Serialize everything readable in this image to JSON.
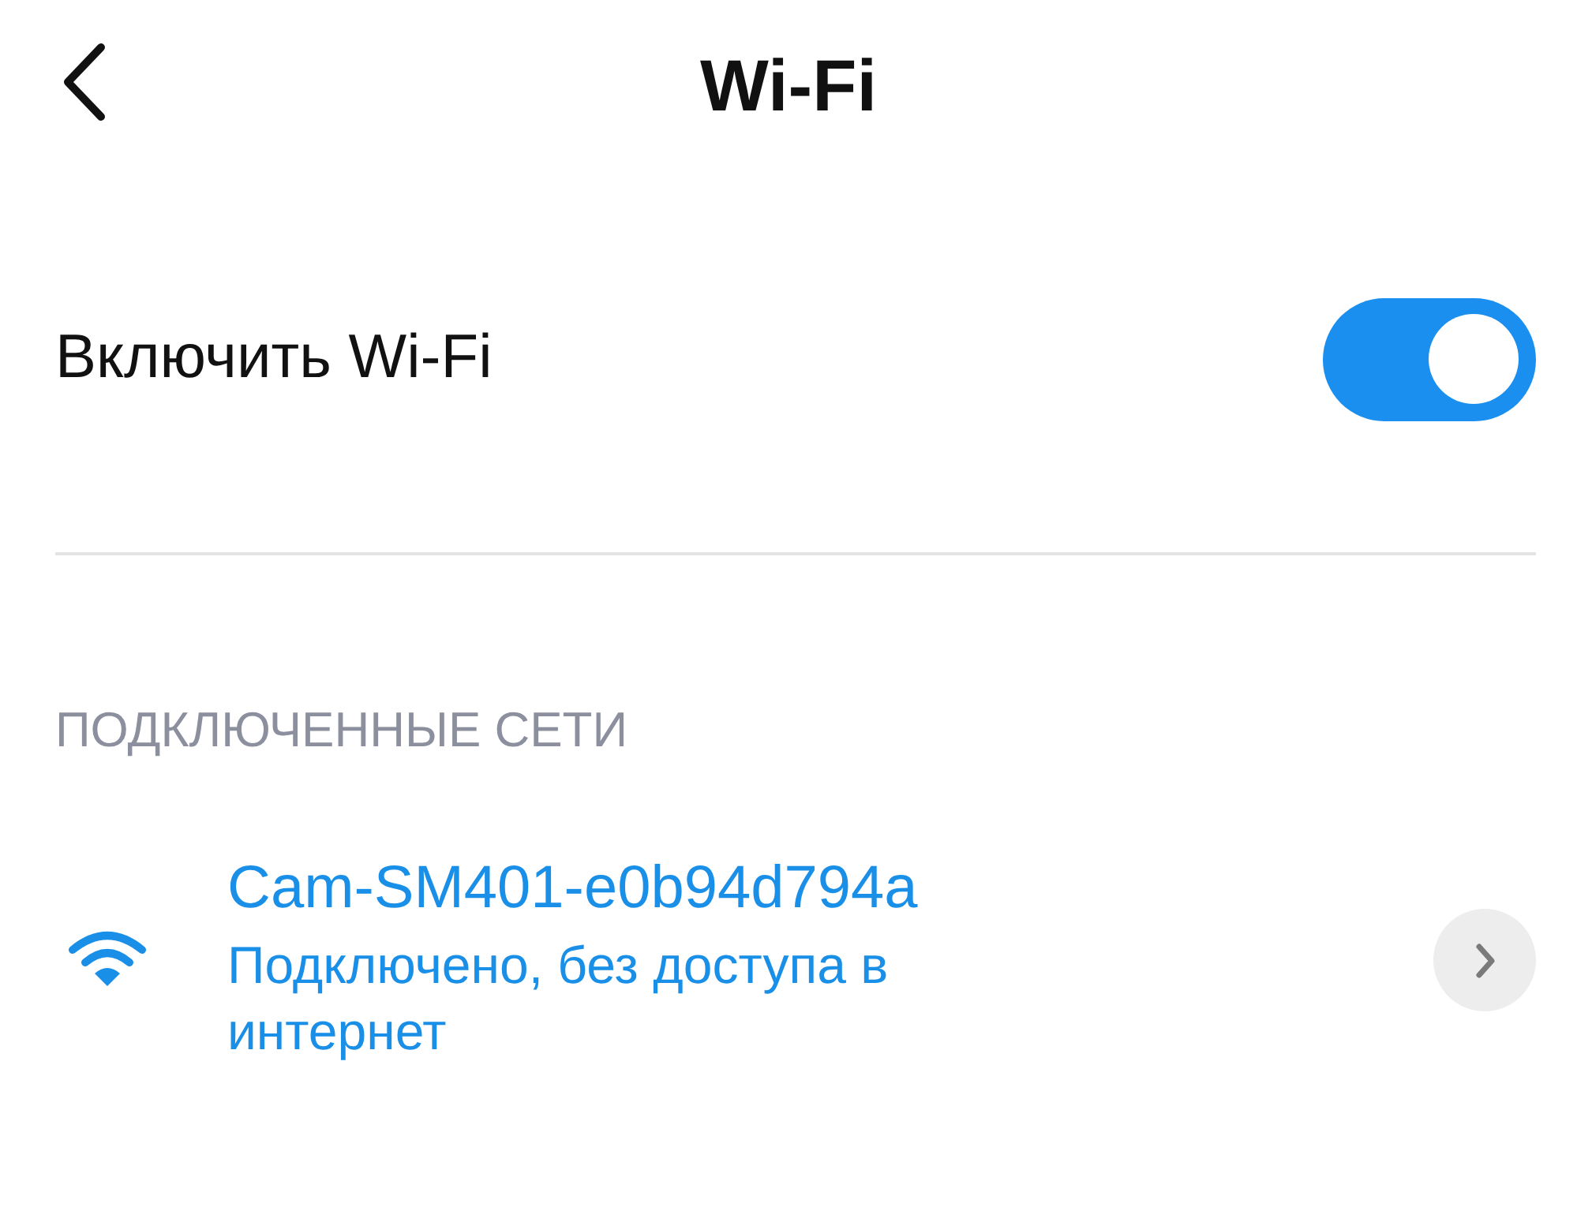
{
  "header": {
    "title": "Wi-Fi"
  },
  "wifi_toggle": {
    "label": "Включить Wi-Fi",
    "on": true
  },
  "section_header": "ПОДКЛЮЧЕННЫЕ СЕТИ",
  "networks": [
    {
      "name": "Cam-SM401-e0b94d794a",
      "status": "Подключено, без доступа в интернет"
    }
  ]
}
